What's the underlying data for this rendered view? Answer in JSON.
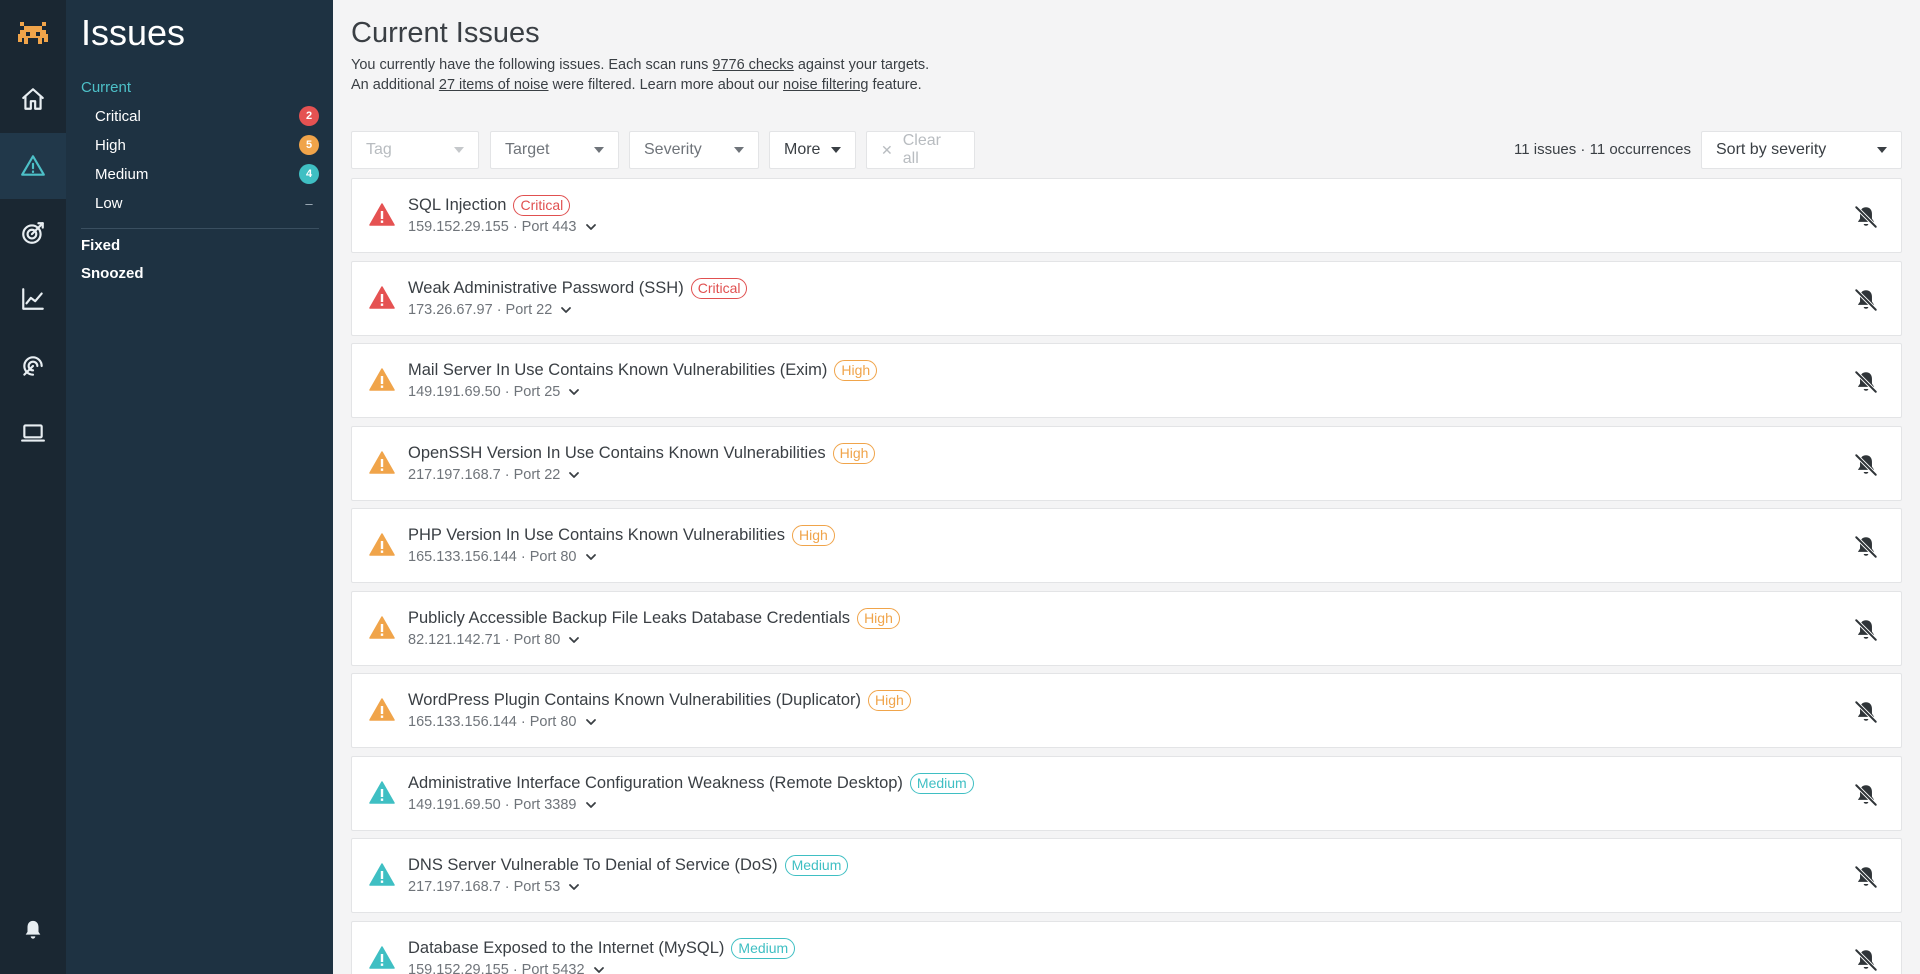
{
  "colors": {
    "critical": "#e55252",
    "high": "#f0a44a",
    "medium": "#3fbfc3",
    "accent": "#4dc0c8"
  },
  "rail": {
    "logo": "invader-logo-icon",
    "items": [
      "home-icon",
      "warning-icon",
      "target-icon",
      "chart-icon",
      "radar-icon",
      "laptop-icon"
    ],
    "bell": "bell-icon"
  },
  "sidebar": {
    "title": "Issues",
    "current_label": "Current",
    "subitems": [
      {
        "label": "Critical",
        "count": "2",
        "severity": "critical"
      },
      {
        "label": "High",
        "count": "5",
        "severity": "high"
      },
      {
        "label": "Medium",
        "count": "4",
        "severity": "medium"
      },
      {
        "label": "Low",
        "count": "–",
        "severity": "low"
      }
    ],
    "fixed_label": "Fixed",
    "snoozed_label": "Snoozed"
  },
  "main": {
    "title": "Current Issues",
    "intro": {
      "l1_a": "You currently have the following issues. Each scan runs ",
      "l1_link": "9776 checks",
      "l1_b": " against your targets.",
      "l2_a": "An additional ",
      "l2_link1": "27 items of noise",
      "l2_b": " were filtered. Learn more about our ",
      "l2_link2": "noise filtering",
      "l2_c": " feature."
    },
    "filters": {
      "tag": "Tag",
      "target": "Target",
      "severity": "Severity",
      "more": "More",
      "clear_all": "Clear all"
    },
    "summary": "11 issues · 11 occurrences",
    "sort": "Sort by severity"
  },
  "issues": [
    {
      "title": "SQL Injection",
      "severity": "critical",
      "label": "Critical",
      "meta": "159.152.29.155 · Port 443"
    },
    {
      "title": "Weak Administrative Password (SSH)",
      "severity": "critical",
      "label": "Critical",
      "meta": "173.26.67.97 · Port 22"
    },
    {
      "title": "Mail Server In Use Contains Known Vulnerabilities (Exim)",
      "severity": "high",
      "label": "High",
      "meta": "149.191.69.50 · Port 25"
    },
    {
      "title": "OpenSSH Version In Use Contains Known Vulnerabilities",
      "severity": "high",
      "label": "High",
      "meta": "217.197.168.7 · Port 22"
    },
    {
      "title": "PHP Version In Use Contains Known Vulnerabilities",
      "severity": "high",
      "label": "High",
      "meta": "165.133.156.144 · Port 80"
    },
    {
      "title": "Publicly Accessible Backup File Leaks Database Credentials",
      "severity": "high",
      "label": "High",
      "meta": "82.121.142.71 · Port 80"
    },
    {
      "title": "WordPress Plugin Contains Known Vulnerabilities (Duplicator)",
      "severity": "high",
      "label": "High",
      "meta": "165.133.156.144 · Port 80"
    },
    {
      "title": "Administrative Interface Configuration Weakness (Remote Desktop)",
      "severity": "medium",
      "label": "Medium",
      "meta": "149.191.69.50 · Port 3389"
    },
    {
      "title": "DNS Server Vulnerable To Denial of Service (DoS)",
      "severity": "medium",
      "label": "Medium",
      "meta": "217.197.168.7 · Port 53"
    },
    {
      "title": "Database Exposed to the Internet (MySQL)",
      "severity": "medium",
      "label": "Medium",
      "meta": "159.152.29.155 · Port 5432"
    }
  ]
}
